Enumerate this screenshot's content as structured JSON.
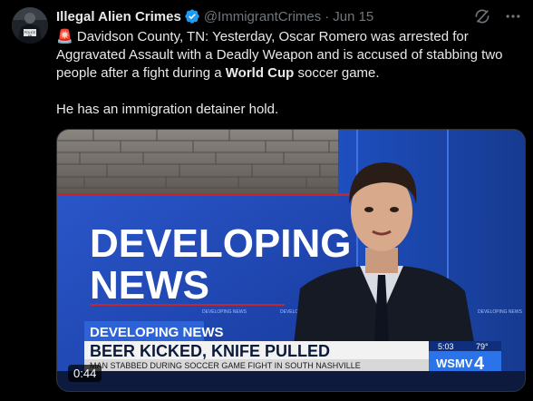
{
  "tweet": {
    "display_name": "Illegal Alien Crimes",
    "handle": "@ImmigrantCrimes",
    "separator": "·",
    "time": "Jun 15",
    "alert_emoji": "🚨",
    "text_part1": " Davidson County, TN: Yesterday, Oscar Romero was arrested for Aggravated Assault with a Deadly Weapon and is accused of stabbing two people after a fight during a ",
    "text_bold": "World Cup",
    "text_part2": " soccer game.",
    "text_line2": "He has an immigration detainer hold.",
    "verified_color": "#1d9bf0"
  },
  "avatar": {
    "badge_text": "POLICE",
    "badge_sub": "ICE"
  },
  "media": {
    "duration": "0:44",
    "wall_text_line1": "DEVELOPING",
    "wall_text_line2": "NEWS",
    "small_wall_label": "DEVELOPING NEWS",
    "lower_third_tag": "DEVELOPING NEWS",
    "headline": "BEER KICKED, KNIFE PULLED",
    "subheadline": "MAN STABBED DURING SOCCER GAME FIGHT IN SOUTH NASHVILLE",
    "clock": "5:03",
    "temperature": "79°",
    "station": "WSMV",
    "channel": "4"
  },
  "icons": {
    "verified": "verified-badge-icon",
    "grok": "grok-icon",
    "more": "more-options-icon"
  }
}
